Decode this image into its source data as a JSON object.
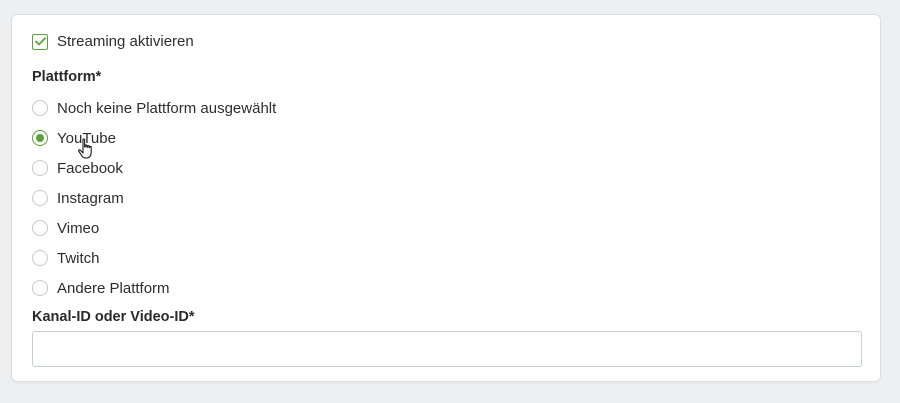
{
  "streaming": {
    "enable_label": "Streaming aktivieren",
    "enabled": true
  },
  "platform": {
    "label": "Plattform*",
    "options": [
      {
        "label": "Noch keine Plattform ausgewählt",
        "selected": false
      },
      {
        "label": "YouTube",
        "selected": true
      },
      {
        "label": "Facebook",
        "selected": false
      },
      {
        "label": "Instagram",
        "selected": false
      },
      {
        "label": "Vimeo",
        "selected": false
      },
      {
        "label": "Twitch",
        "selected": false
      },
      {
        "label": "Andere Plattform",
        "selected": false
      }
    ]
  },
  "channel": {
    "label": "Kanal-ID oder Video-ID*",
    "value": "",
    "placeholder": ""
  },
  "colors": {
    "accent": "#5aa33a",
    "card_background": "#ffffff",
    "page_background": "#eeeff1"
  },
  "icons": {
    "checkbox": "check-icon",
    "cursor": "hand-pointer-icon"
  }
}
